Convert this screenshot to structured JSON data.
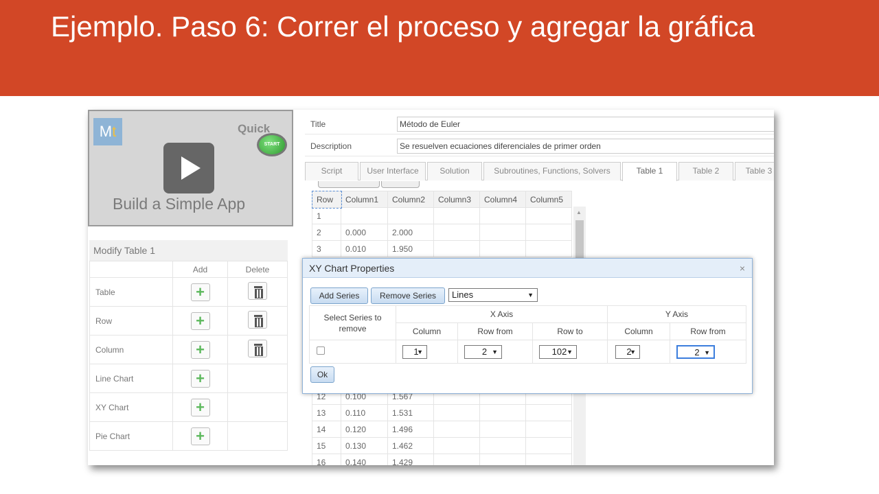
{
  "slide": {
    "title": "Ejemplo. Paso 6: Correr el proceso y agregar la gráfica"
  },
  "video": {
    "logo_m": "M",
    "logo_t": "t",
    "quick": "Quick",
    "start": "START",
    "caption": "Build a Simple App"
  },
  "modify": {
    "title": "Modify Table 1",
    "add_header": "Add",
    "delete_header": "Delete",
    "rows": [
      {
        "label": "Table",
        "add": true,
        "delete": true
      },
      {
        "label": "Row",
        "add": true,
        "delete": true
      },
      {
        "label": "Column",
        "add": true,
        "delete": true
      },
      {
        "label": "Line Chart",
        "add": true,
        "delete": false
      },
      {
        "label": "XY Chart",
        "add": true,
        "delete": false
      },
      {
        "label": "Pie Chart",
        "add": true,
        "delete": false
      }
    ]
  },
  "form": {
    "title_label": "Title",
    "title_value": "Método de Euler",
    "desc_label": "Description",
    "desc_value": "Se resuelven ecuaciones diferenciales de primer orden"
  },
  "tabs": [
    "Script",
    "User Interface",
    "Solution",
    "Subroutines, Functions, Solvers",
    "Table 1",
    "Table 2",
    "Table 3"
  ],
  "active_tab": "Table 1",
  "grid": {
    "headers": [
      "Row",
      "Column1",
      "Column2",
      "Column3",
      "Column4",
      "Column5"
    ],
    "rows_top": [
      [
        "1",
        "",
        ""
      ],
      [
        "2",
        "0.000",
        "2.000"
      ],
      [
        "3",
        "0.010",
        "1.950"
      ]
    ],
    "rows_bottom": [
      [
        "12",
        "0.100",
        "1.567"
      ],
      [
        "13",
        "0.110",
        "1.531"
      ],
      [
        "14",
        "0.120",
        "1.496"
      ],
      [
        "15",
        "0.130",
        "1.462"
      ],
      [
        "16",
        "0.140",
        "1.429"
      ]
    ]
  },
  "dialog": {
    "title": "XY Chart Properties",
    "close": "×",
    "add_series": "Add Series",
    "remove_series": "Remove Series",
    "chart_style": "Lines",
    "select_header": "Select Series to remove",
    "x_axis": "X Axis",
    "y_axis": "Y Axis",
    "col_column": "Column",
    "col_row_from": "Row from",
    "col_row_to": "Row to",
    "x_column": "1",
    "x_row_from": "2",
    "x_row_to": "102",
    "y_column": "2",
    "y_row_from": "2",
    "ok": "Ok"
  },
  "colors": {
    "header_bg": "#d24726",
    "dialog_title_bg": "#e4eef9",
    "add_green": "#5cb85c"
  }
}
